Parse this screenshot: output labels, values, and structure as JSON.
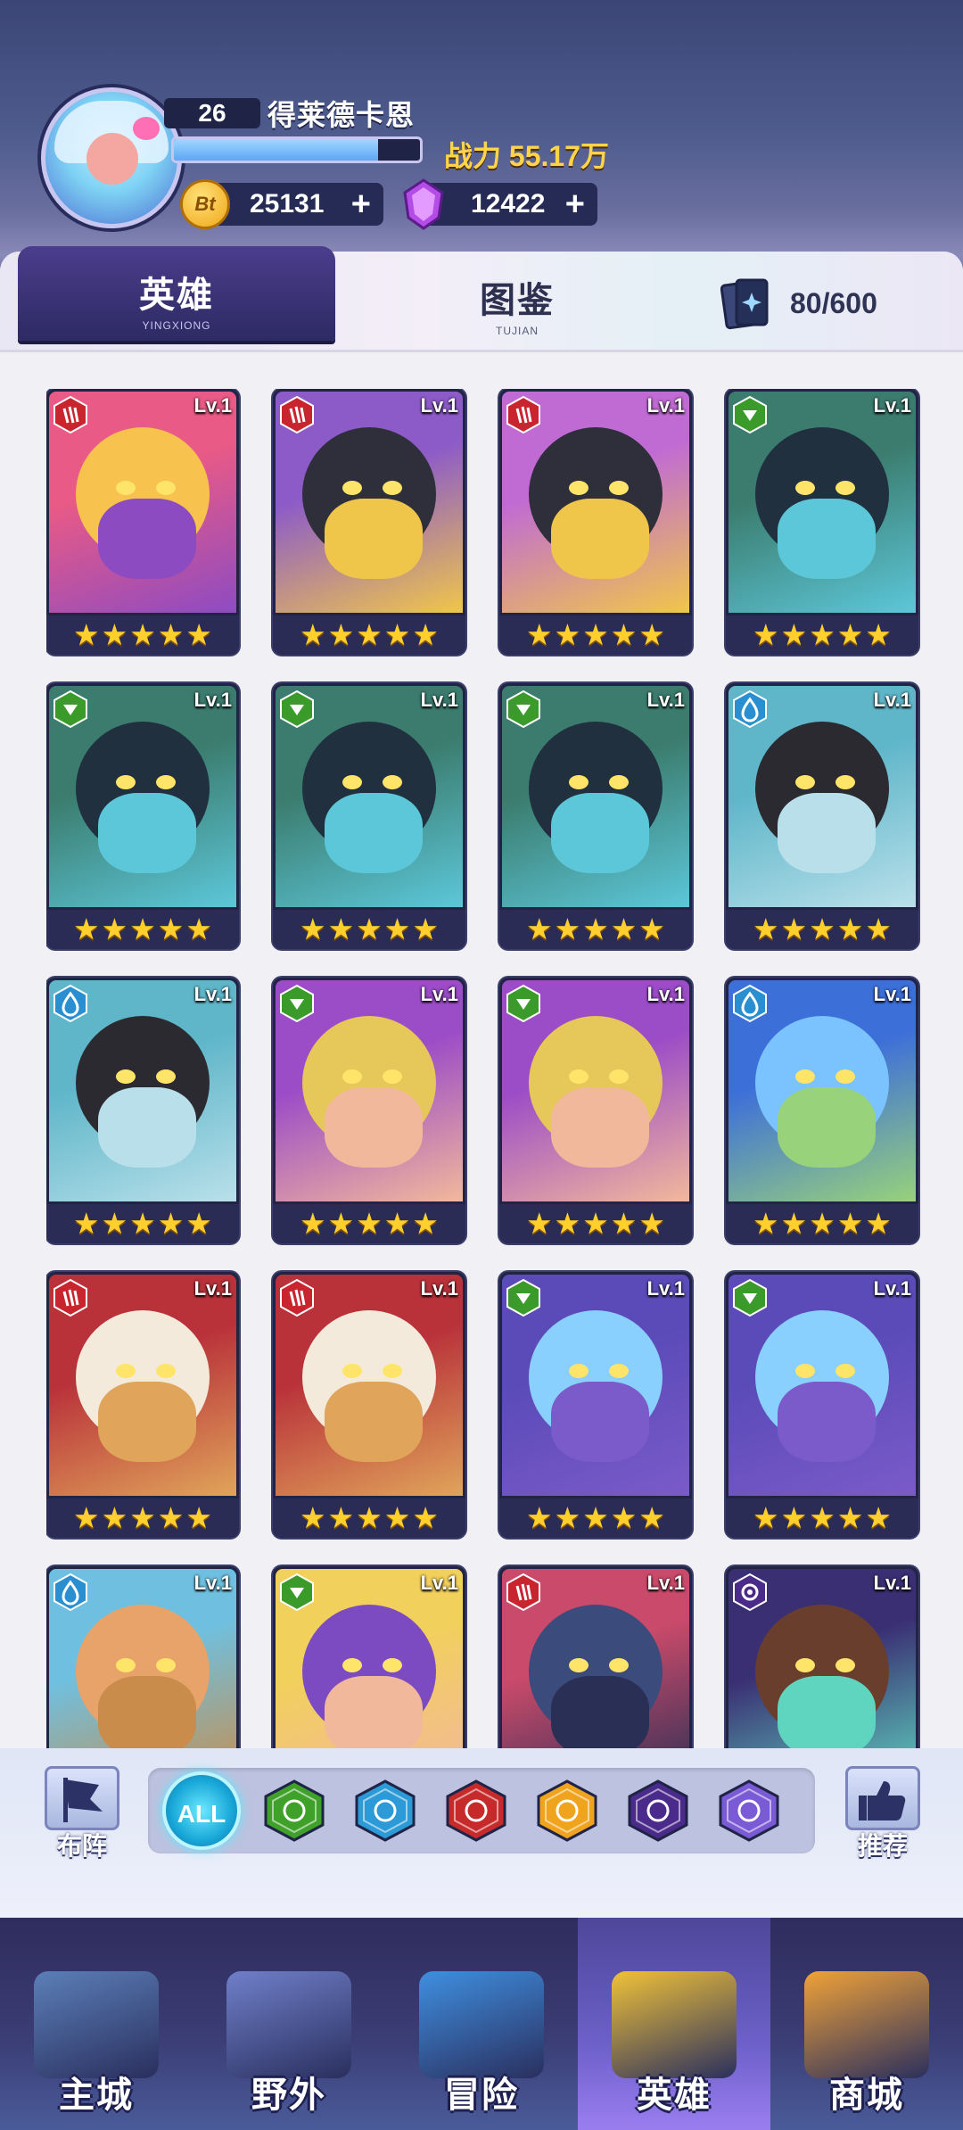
{
  "player": {
    "level": "26",
    "name": "得莱德卡恩",
    "xp_fraction": 0.83,
    "power_label": "战力 55.17万"
  },
  "currency": {
    "gold_icon_text": "Bt",
    "gold": "25131",
    "gems": "12422",
    "plus": "+"
  },
  "tabs": {
    "heroes": {
      "label": "英雄",
      "sub": "YINGXIONG"
    },
    "codex": {
      "label": "图鉴",
      "sub": "TUJIAN"
    },
    "collection_count": "80/600"
  },
  "level_text": "Lv.1",
  "star_glyph": "★",
  "heroes": [
    {
      "faction": "red",
      "palette": [
        "#e95a86",
        "#f7c24e",
        "#8d4bc2"
      ]
    },
    {
      "faction": "red",
      "palette": [
        "#8c5bc8",
        "#2e2f3a",
        "#f0c64a"
      ]
    },
    {
      "faction": "red",
      "palette": [
        "#c06bd3",
        "#2e2f3a",
        "#f0c64a"
      ]
    },
    {
      "faction": "green",
      "palette": [
        "#3b7c6e",
        "#21303e",
        "#5cc7d9"
      ]
    },
    {
      "faction": "green",
      "palette": [
        "#3b7c6e",
        "#21303e",
        "#5cc7d9"
      ]
    },
    {
      "faction": "green",
      "palette": [
        "#3b7c6e",
        "#21303e",
        "#5cc7d9"
      ]
    },
    {
      "faction": "green",
      "palette": [
        "#3b7c6e",
        "#21303e",
        "#5cc7d9"
      ]
    },
    {
      "faction": "blue",
      "palette": [
        "#5fb6c9",
        "#2b2a30",
        "#b9e0ea"
      ]
    },
    {
      "faction": "blue",
      "palette": [
        "#5fb6c9",
        "#2b2a30",
        "#b9e0ea"
      ]
    },
    {
      "faction": "green",
      "palette": [
        "#9b4cc7",
        "#e6c75a",
        "#f2b89b"
      ]
    },
    {
      "faction": "green",
      "palette": [
        "#9b4cc7",
        "#e6c75a",
        "#f2b89b"
      ]
    },
    {
      "faction": "blue",
      "palette": [
        "#3d6fd9",
        "#7ac3ff",
        "#98d27a"
      ]
    },
    {
      "faction": "red",
      "palette": [
        "#b9323a",
        "#f3eadb",
        "#e0a45a"
      ]
    },
    {
      "faction": "red",
      "palette": [
        "#b9323a",
        "#f3eadb",
        "#e0a45a"
      ]
    },
    {
      "faction": "green",
      "palette": [
        "#5a4bb8",
        "#8ad0ff",
        "#7b5ac9"
      ]
    },
    {
      "faction": "green",
      "palette": [
        "#5a4bb8",
        "#8ad0ff",
        "#7b5ac9"
      ]
    },
    {
      "faction": "blue",
      "palette": [
        "#6fc0e0",
        "#e7a36a",
        "#c98c4a"
      ]
    },
    {
      "faction": "green",
      "palette": [
        "#f2d05c",
        "#7c4bc2",
        "#f2b89b"
      ]
    },
    {
      "faction": "red",
      "palette": [
        "#c94a6a",
        "#3b4b7c",
        "#2a2f55"
      ]
    },
    {
      "faction": "purple",
      "palette": [
        "#3a2f73",
        "#6a3e2c",
        "#5fd5c0"
      ]
    }
  ],
  "filters": {
    "left_label": "布阵",
    "right_label": "推荐",
    "all_label": "ALL",
    "factions": [
      {
        "name": "nature",
        "color": "#3fa02a"
      },
      {
        "name": "water",
        "color": "#2b9ad6"
      },
      {
        "name": "fire",
        "color": "#c72a2a"
      },
      {
        "name": "light",
        "color": "#f0a31c"
      },
      {
        "name": "dark",
        "color": "#4a2a8a"
      },
      {
        "name": "void",
        "color": "#7b5ad6"
      }
    ]
  },
  "nav": [
    {
      "label": "主城",
      "color": "#5b7fb8"
    },
    {
      "label": "野外",
      "color": "#6f7fc9"
    },
    {
      "label": "冒险",
      "color": "#3f8fe0"
    },
    {
      "label": "英雄",
      "color": "#f0c238"
    },
    {
      "label": "商城",
      "color": "#f0a238"
    }
  ]
}
